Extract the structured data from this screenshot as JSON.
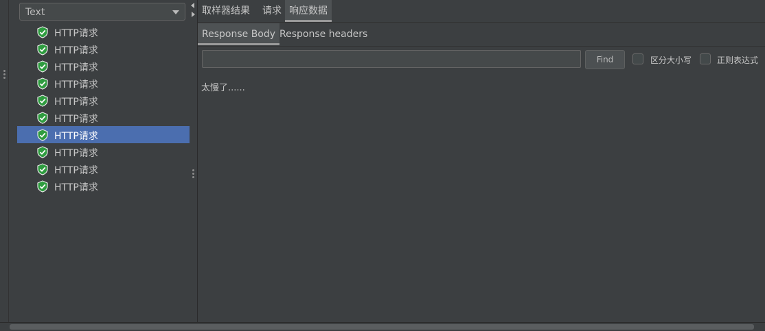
{
  "renderer": {
    "selected": "Text"
  },
  "tree": {
    "items": [
      {
        "label": "HTTP请求",
        "selected": false
      },
      {
        "label": "HTTP请求",
        "selected": false
      },
      {
        "label": "HTTP请求",
        "selected": false
      },
      {
        "label": "HTTP请求",
        "selected": false
      },
      {
        "label": "HTTP请求",
        "selected": false
      },
      {
        "label": "HTTP请求",
        "selected": false
      },
      {
        "label": "HTTP请求",
        "selected": true
      },
      {
        "label": "HTTP请求",
        "selected": false
      },
      {
        "label": "HTTP请求",
        "selected": false
      },
      {
        "label": "HTTP请求",
        "selected": false
      }
    ],
    "icon": "success-shield-icon"
  },
  "tabs": [
    {
      "label": "取样器结果"
    },
    {
      "label": "请求"
    },
    {
      "label": "响应数据",
      "active": true
    }
  ],
  "subtabs": [
    {
      "label": "Response Body",
      "active": true
    },
    {
      "label": "Response headers"
    }
  ],
  "search": {
    "value": "",
    "placeholder": "",
    "find_label": "Find"
  },
  "options": {
    "case_sensitive_label": "区分大小写",
    "case_sensitive_checked": false,
    "regex_label": "正则表达式",
    "regex_checked": false
  },
  "response": {
    "body": "太慢了......"
  },
  "colors": {
    "background": "#3c3f41",
    "selection": "#4b6eaf",
    "success_green": "#2e9c3f",
    "text": "#bbbbbb"
  }
}
